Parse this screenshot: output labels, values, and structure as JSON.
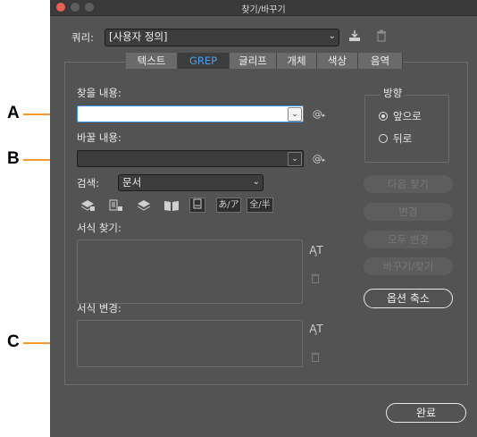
{
  "window": {
    "title": "찾기/바꾸기"
  },
  "query": {
    "label": "쿼리:",
    "value": "[사용자 정의]"
  },
  "tabs": [
    {
      "label": "텍스트",
      "active": false
    },
    {
      "label": "GREP",
      "active": true
    },
    {
      "label": "글리프",
      "active": false
    },
    {
      "label": "개체",
      "active": false
    },
    {
      "label": "색상",
      "active": false
    },
    {
      "label": "음역",
      "active": false
    }
  ],
  "find": {
    "label": "찾을 내용:",
    "value": ""
  },
  "change": {
    "label": "바꿀 내용:",
    "value": ""
  },
  "search": {
    "label": "검색:",
    "value": "문서"
  },
  "option_icons": [
    "locked-layers-icon",
    "locked-stories-icon",
    "hidden-layers-icon",
    "master-pages-icon",
    "footnotes-icon",
    "kana-sensitive-icon",
    "width-sensitive-icon"
  ],
  "option_labels": {
    "kana": "あ/ア",
    "width": "全/半"
  },
  "find_format": {
    "label": "서식 찾기:"
  },
  "change_format": {
    "label": "서식 변경:"
  },
  "direction": {
    "label": "방향",
    "options": [
      {
        "label": "앞으로",
        "selected": true
      },
      {
        "label": "뒤로",
        "selected": false
      }
    ]
  },
  "buttons": {
    "find_next": "다음 찾기",
    "change": "변경",
    "change_all": "모두 변경",
    "change_find": "바꾸기/찾기",
    "fewer_options": "옵션 축소",
    "done": "완료"
  },
  "callouts": {
    "a": "A",
    "b": "B",
    "c": "C"
  },
  "colors": {
    "accent": "#4a9dec",
    "callout_line": "#f59a2e",
    "panel_bg": "#535353"
  }
}
